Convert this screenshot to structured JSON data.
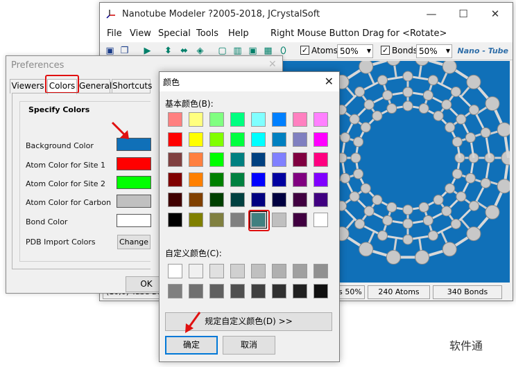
{
  "main_window": {
    "title": "Nanotube Modeler ?2005-2018, JCrystalSoft",
    "controls": {
      "minimize": "—",
      "maximize": "☐",
      "close": "✕"
    },
    "menu": [
      "File",
      "View",
      "Special",
      "Tools",
      "Help"
    ],
    "menu_hint": "Right Mouse Button Drag for <Rotate>",
    "toolbar": {
      "atoms_label": "Atoms",
      "atoms_value": "50%",
      "bonds_label": "Bonds",
      "bonds_value": "50%",
      "brand": "Nano - Tube"
    },
    "status": {
      "left": "(10,0) Tube Diam",
      "pct": "s 50%",
      "atoms": "240 Atoms",
      "bonds": "340 Bonds"
    },
    "viewport_color": "#1070b8"
  },
  "preferences": {
    "title": "Preferences",
    "tabs": [
      "Viewers",
      "Colors",
      "General",
      "Shortcuts"
    ],
    "group_title": "Specify Colors",
    "rows": [
      {
        "label": "Background Color",
        "color": "#1070b8"
      },
      {
        "label": "Atom Color for Site 1",
        "color": "#ff0000"
      },
      {
        "label": "Atom Color for Site 2",
        "color": "#00ff00"
      },
      {
        "label": "Atom Color for Carbon",
        "color": "#c0c0c0"
      },
      {
        "label": "Bond Color",
        "color": "#ffffff"
      }
    ],
    "pdb_label": "PDB Import Colors",
    "change_label": "Change",
    "ok_label": "OK"
  },
  "color_dialog": {
    "title": "颜色",
    "basic_label": "基本颜色(B):",
    "custom_label": "自定义颜色(C):",
    "define_label": "规定自定义颜色(D) >>",
    "ok_label": "确定",
    "cancel_label": "取消",
    "basic_colors": [
      [
        "#ff8080",
        "#ffff80",
        "#80ff80",
        "#00ff80",
        "#80ffff",
        "#0080ff",
        "#ff80c0",
        "#ff80ff"
      ],
      [
        "#ff0000",
        "#ffff00",
        "#80ff00",
        "#00ff40",
        "#00ffff",
        "#0080c0",
        "#8080c0",
        "#ff00ff"
      ],
      [
        "#804040",
        "#ff8040",
        "#00ff00",
        "#008080",
        "#004080",
        "#8080ff",
        "#800040",
        "#ff0080"
      ],
      [
        "#800000",
        "#ff8000",
        "#008000",
        "#008040",
        "#0000ff",
        "#0000a0",
        "#800080",
        "#8000ff"
      ],
      [
        "#400000",
        "#804000",
        "#004000",
        "#004040",
        "#000080",
        "#000040",
        "#400040",
        "#400080"
      ],
      [
        "#000000",
        "#808000",
        "#808040",
        "#808080",
        "#408080",
        "#c0c0c0",
        "#400040",
        "#ffffff"
      ]
    ],
    "selected": {
      "row": 5,
      "col": 4
    },
    "custom_colors": [
      [
        "#ffffff",
        "#f0f0f0",
        "#e0e0e0",
        "#d0d0d0",
        "#c0c0c0",
        "#b0b0b0",
        "#a0a0a0",
        "#909090"
      ],
      [
        "#808080",
        "#707070",
        "#606060",
        "#505050",
        "#404040",
        "#303030",
        "#202020",
        "#101010"
      ]
    ]
  },
  "watermark": "软件通"
}
